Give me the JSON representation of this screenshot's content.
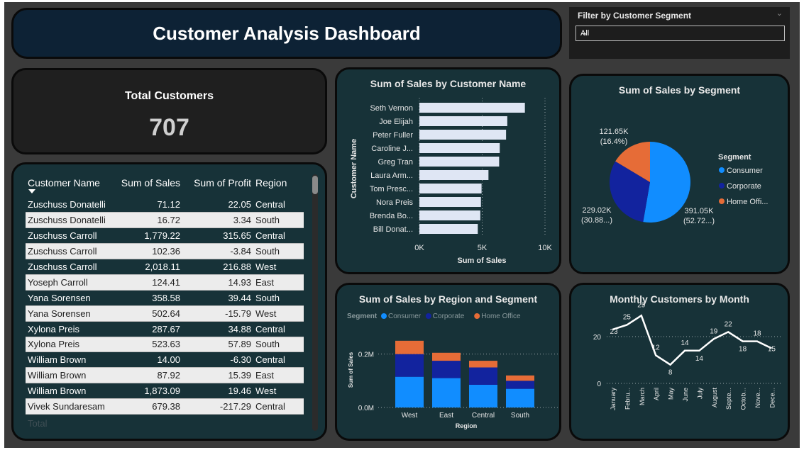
{
  "title": "Customer Analysis Dashboard",
  "filter": {
    "label": "Filter by Customer Segment",
    "value": "All"
  },
  "kpi": {
    "label": "Total Customers",
    "value": "707"
  },
  "table": {
    "columns": [
      "Customer Name",
      "Sum of Sales",
      "Sum of Profit",
      "Region"
    ],
    "rows": [
      [
        "Zuschuss Donatelli",
        "71.12",
        "22.05",
        "Central"
      ],
      [
        "Zuschuss Donatelli",
        "16.72",
        "3.34",
        "South"
      ],
      [
        "Zuschuss Carroll",
        "1,779.22",
        "315.65",
        "Central"
      ],
      [
        "Zuschuss Carroll",
        "102.36",
        "-3.84",
        "South"
      ],
      [
        "Zuschuss Carroll",
        "2,018.11",
        "216.88",
        "West"
      ],
      [
        "Yoseph Carroll",
        "124.41",
        "14.93",
        "East"
      ],
      [
        "Yana Sorensen",
        "358.58",
        "39.44",
        "South"
      ],
      [
        "Yana Sorensen",
        "502.64",
        "-15.79",
        "West"
      ],
      [
        "Xylona Preis",
        "287.67",
        "34.88",
        "Central"
      ],
      [
        "Xylona Preis",
        "523.63",
        "57.89",
        "South"
      ],
      [
        "William Brown",
        "14.00",
        "-6.30",
        "Central"
      ],
      [
        "William Brown",
        "87.92",
        "15.39",
        "East"
      ],
      [
        "William Brown",
        "1,873.09",
        "19.46",
        "West"
      ],
      [
        "Vivek Sundaresam",
        "679.38",
        "-217.29",
        "Central"
      ]
    ],
    "total_label": "Total"
  },
  "chart_data": [
    {
      "type": "bar",
      "orientation": "horizontal",
      "title": "Sum of Sales by Customer Name",
      "xlabel": "Sum of Sales",
      "ylabel": "Customer Name",
      "categories": [
        "Seth Vernon",
        "Joe Elijah",
        "Peter Fuller",
        "Caroline J...",
        "Greg Tran",
        "Laura Arm...",
        "Tom Presc...",
        "Nora Preis",
        "Brenda Bo...",
        "Bill Donat..."
      ],
      "values": [
        8400,
        7000,
        6900,
        6400,
        6350,
        5500,
        4950,
        4900,
        4850,
        4650
      ],
      "xticks": [
        "0K",
        "5K",
        "10K"
      ],
      "xlim": [
        0,
        10000
      ],
      "bar_color": "#dfe6f4"
    },
    {
      "type": "pie",
      "title": "Sum of Sales by Segment",
      "legend_title": "Segment",
      "slices": [
        {
          "name": "Consumer",
          "value": 391.05,
          "label": "391.05K",
          "pct": "(52.72...)",
          "color": "#118dff"
        },
        {
          "name": "Corporate",
          "value": 229.02,
          "label": "229.02K",
          "pct": "(30.88...)",
          "color": "#12239e"
        },
        {
          "name": "Home Office",
          "value": 121.65,
          "label": "121.65K",
          "pct": "(16.4%)",
          "color": "#e66c37"
        }
      ],
      "legend_labels": [
        "Consumer",
        "Corporate",
        "Home Offi..."
      ]
    },
    {
      "type": "bar",
      "stacked": true,
      "title": "Sum of Sales by Region and Segment",
      "legend_title": "Segment",
      "xlabel": "Region",
      "ylabel": "Sum of Sales",
      "categories": [
        "West",
        "East",
        "Central",
        "South"
      ],
      "yticks": [
        "0.0M",
        "0.2M"
      ],
      "ylim": [
        0,
        0.3
      ],
      "series": [
        {
          "name": "Consumer",
          "color": "#118dff",
          "values": [
            0.115,
            0.11,
            0.085,
            0.07
          ]
        },
        {
          "name": "Corporate",
          "color": "#12239e",
          "values": [
            0.085,
            0.065,
            0.065,
            0.03
          ]
        },
        {
          "name": "Home Office",
          "color": "#e66c37",
          "values": [
            0.05,
            0.03,
            0.025,
            0.02
          ]
        }
      ]
    },
    {
      "type": "line",
      "title": "Monthly Customers by Month",
      "categories": [
        "January",
        "Febru...",
        "March",
        "April",
        "May",
        "June",
        "July",
        "August",
        "Septe...",
        "Octob...",
        "Nove...",
        "Dece..."
      ],
      "values": [
        23,
        25,
        29,
        12,
        8,
        14,
        14,
        19,
        22,
        18,
        18,
        15
      ],
      "yticks": [
        "0",
        "20"
      ],
      "ylim": [
        0,
        30
      ],
      "line_color": "#ffffff"
    }
  ]
}
